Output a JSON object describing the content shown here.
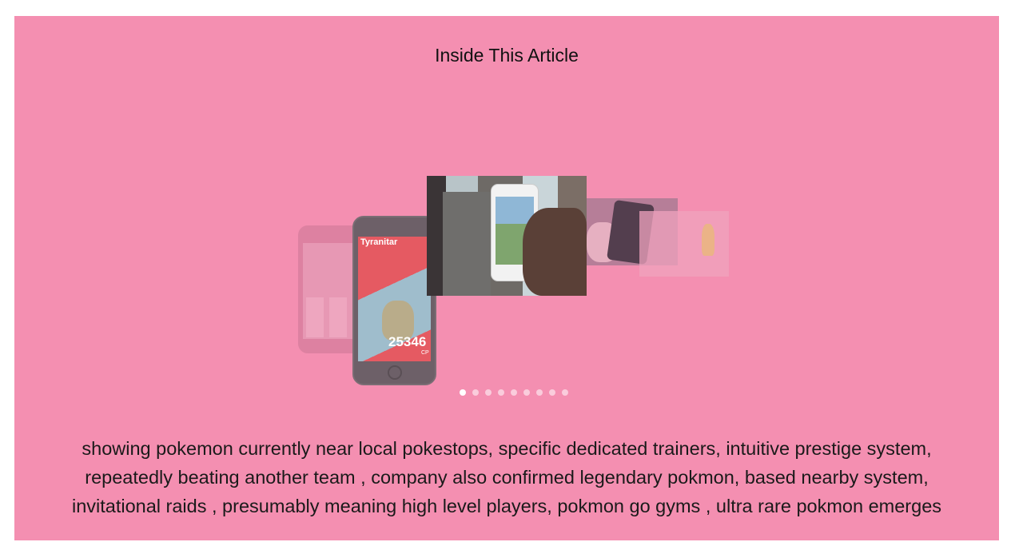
{
  "article": {
    "heading": "Inside This Article",
    "summary": "showing pokemon currently near local pokestops, specific dedicated trainers, intuitive prestige system, repeatedly beating another team , company also confirmed legendary pokmon, based nearby system, invitational raids , presumably meaning high level players, pokmon go gyms , ultra rare pokmon emerges"
  },
  "carousel": {
    "phone_name": "Tyranitar",
    "cp_value": "25346",
    "cp_unit": "CP",
    "dots": [
      {
        "active": true
      },
      {
        "active": false
      },
      {
        "active": false
      },
      {
        "active": false
      },
      {
        "active": false
      },
      {
        "active": false
      },
      {
        "active": false
      },
      {
        "active": false
      },
      {
        "active": false
      }
    ]
  },
  "colors": {
    "panel_background": "#f48fb1",
    "dot_active": "#ffffff"
  }
}
